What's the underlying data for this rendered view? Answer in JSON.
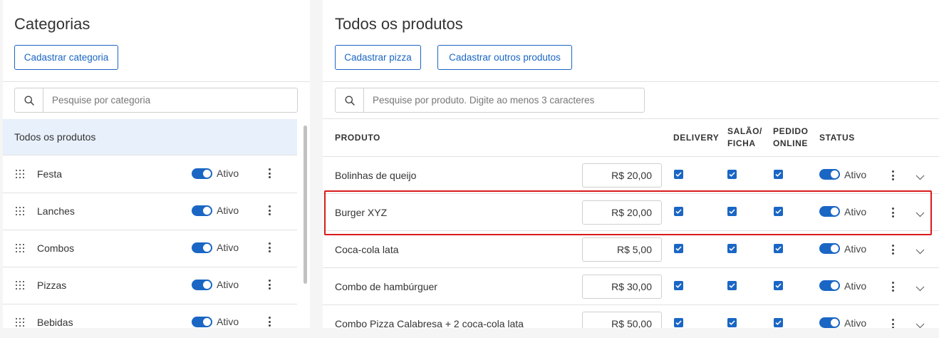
{
  "categories_panel": {
    "title": "Categorias",
    "add_button": "Cadastrar categoria",
    "search_placeholder": "Pesquise por categoria",
    "all_products_label": "Todos os produtos",
    "items": [
      {
        "name": "Festa",
        "status": "Ativo",
        "active": true
      },
      {
        "name": "Lanches",
        "status": "Ativo",
        "active": true
      },
      {
        "name": "Combos",
        "status": "Ativo",
        "active": true
      },
      {
        "name": "Pizzas",
        "status": "Ativo",
        "active": true
      },
      {
        "name": "Bebidas",
        "status": "Ativo",
        "active": true
      }
    ]
  },
  "products_panel": {
    "title": "Todos os produtos",
    "add_pizza_button": "Cadastrar pizza",
    "add_other_button": "Cadastrar outros produtos",
    "search_placeholder": "Pesquise por produto. Digite ao menos 3 caracteres",
    "columns": {
      "product": "PRODUTO",
      "delivery": "DELIVERY",
      "salao_1": "SALÃO/",
      "salao_2": "FICHA",
      "pedido_1": "PEDIDO",
      "pedido_2": "ONLINE",
      "status": "STATUS"
    },
    "rows": [
      {
        "name": "Bolinhas de queijo",
        "price": "R$ 20,00",
        "delivery": true,
        "salao": true,
        "online": true,
        "status": "Ativo"
      },
      {
        "name": "Burger XYZ",
        "price": "R$ 20,00",
        "delivery": true,
        "salao": true,
        "online": true,
        "status": "Ativo"
      },
      {
        "name": "Coca-cola lata",
        "price": "R$ 5,00",
        "delivery": true,
        "salao": true,
        "online": true,
        "status": "Ativo"
      },
      {
        "name": "Combo de hambúrguer",
        "price": "R$ 30,00",
        "delivery": true,
        "salao": true,
        "online": true,
        "status": "Ativo"
      },
      {
        "name": "Combo Pizza Calabresa + 2 coca-cola lata",
        "price": "R$ 50,00",
        "delivery": true,
        "salao": true,
        "online": true,
        "status": "Ativo"
      }
    ],
    "highlighted_row": 1
  },
  "colors": {
    "accent": "#1a66c4",
    "selected_bg": "#e8f0fb",
    "highlight_border": "#d81b1b"
  },
  "icons": {
    "search": "search-icon",
    "drag": "drag-handle-icon",
    "menu": "more-vertical-icon",
    "expand": "chevron-down-icon",
    "check": "checkmark-icon"
  }
}
